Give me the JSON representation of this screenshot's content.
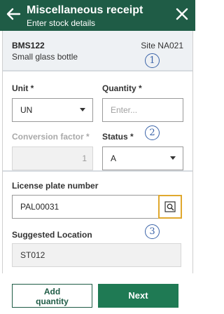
{
  "header": {
    "title": "Miscellaneous receipt",
    "subtitle": "Enter stock details"
  },
  "item": {
    "code": "BMS122",
    "description": "Small glass bottle",
    "site": "Site NA021"
  },
  "markers": [
    "1",
    "2",
    "3"
  ],
  "fields": {
    "unit": {
      "label": "Unit *",
      "value": "UN"
    },
    "quantity": {
      "label": "Quantity *",
      "placeholder": "Enter..."
    },
    "conversion_factor": {
      "label": "Conversion factor *",
      "value": "1"
    },
    "status": {
      "label": "Status *",
      "value": "A"
    },
    "license_plate": {
      "label": "License plate number",
      "value": "PAL00031"
    },
    "suggested_location": {
      "label": "Suggested Location",
      "value": "ST012"
    }
  },
  "buttons": {
    "add_quantity_line1": "Add",
    "add_quantity_line2": "quantity",
    "next": "Next"
  },
  "colors": {
    "header": "#1f5c46",
    "primary_button": "#1f7a54",
    "lookup_highlight": "#e0a82e",
    "marker": "#3a63a8"
  }
}
